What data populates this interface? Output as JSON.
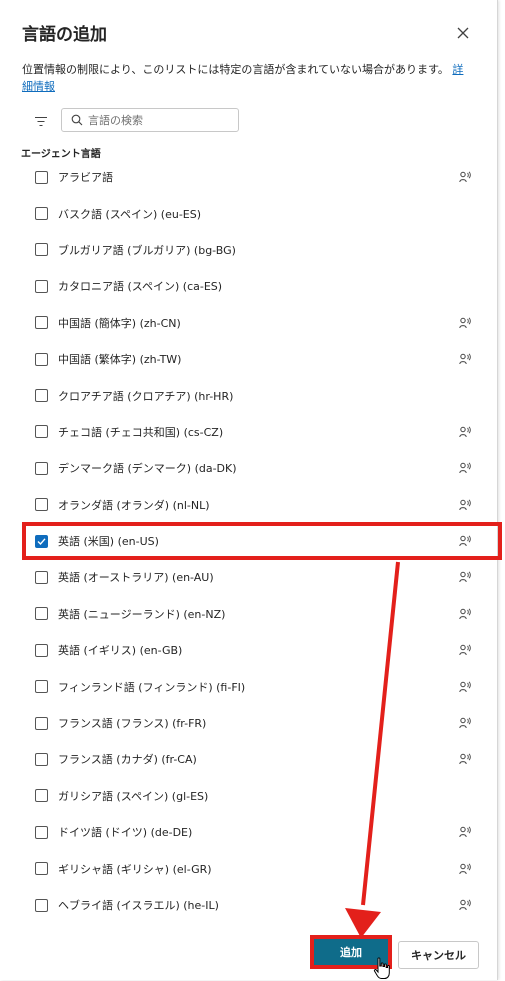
{
  "dialog": {
    "title": "言語の追加",
    "description": "位置情報の制限により、このリストには特定の言語が含まれていない場合があります。",
    "details_link": "詳細情報"
  },
  "search": {
    "placeholder": "言語の検索"
  },
  "section_label": "エージェント言語",
  "languages": [
    {
      "label": "アラビア語",
      "checked": false,
      "voice": true
    },
    {
      "label": "バスク語 (スペイン) (eu-ES)",
      "checked": false,
      "voice": false
    },
    {
      "label": "ブルガリア語 (ブルガリア) (bg-BG)",
      "checked": false,
      "voice": false
    },
    {
      "label": "カタロニア語 (スペイン) (ca-ES)",
      "checked": false,
      "voice": false
    },
    {
      "label": "中国語 (簡体字) (zh-CN)",
      "checked": false,
      "voice": true
    },
    {
      "label": "中国語 (繁体字) (zh-TW)",
      "checked": false,
      "voice": true
    },
    {
      "label": "クロアチア語 (クロアチア) (hr-HR)",
      "checked": false,
      "voice": false
    },
    {
      "label": "チェコ語 (チェコ共和国) (cs-CZ)",
      "checked": false,
      "voice": true
    },
    {
      "label": "デンマーク語 (デンマーク) (da-DK)",
      "checked": false,
      "voice": true
    },
    {
      "label": "オランダ語 (オランダ) (nl-NL)",
      "checked": false,
      "voice": true
    },
    {
      "label": "英語 (米国) (en-US)",
      "checked": true,
      "voice": true
    },
    {
      "label": "英語 (オーストラリア) (en-AU)",
      "checked": false,
      "voice": true
    },
    {
      "label": "英語 (ニュージーランド) (en-NZ)",
      "checked": false,
      "voice": true
    },
    {
      "label": "英語 (イギリス) (en-GB)",
      "checked": false,
      "voice": true
    },
    {
      "label": "フィンランド語 (フィンランド) (fi-FI)",
      "checked": false,
      "voice": true
    },
    {
      "label": "フランス語 (フランス) (fr-FR)",
      "checked": false,
      "voice": true
    },
    {
      "label": "フランス語 (カナダ) (fr-CA)",
      "checked": false,
      "voice": true
    },
    {
      "label": "ガリシア語 (スペイン) (gl-ES)",
      "checked": false,
      "voice": false
    },
    {
      "label": "ドイツ語 (ドイツ) (de-DE)",
      "checked": false,
      "voice": true
    },
    {
      "label": "ギリシャ語 (ギリシャ) (el-GR)",
      "checked": false,
      "voice": true
    },
    {
      "label": "ヘブライ語 (イスラエル) (he-IL)",
      "checked": false,
      "voice": true
    }
  ],
  "buttons": {
    "add": "追加",
    "cancel": "キャンセル"
  },
  "colors": {
    "primary": "#0f6c8a",
    "checkbox": "#0f6cbd",
    "annotation": "#e3201b",
    "link": "#0f6cbd"
  },
  "icons": {
    "close": "close-icon",
    "filter": "filter-icon",
    "search": "search-icon",
    "voice": "voice-icon",
    "check": "checkmark-icon",
    "cursor": "hand-pointer-icon"
  }
}
